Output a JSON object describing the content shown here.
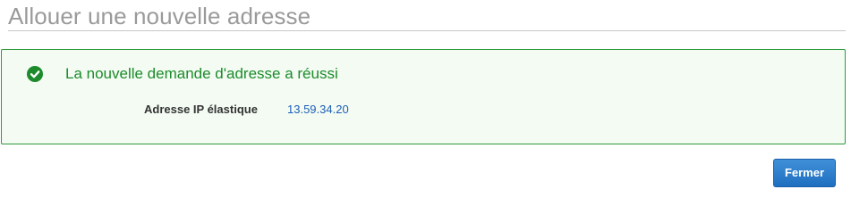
{
  "dialog": {
    "title": "Allouer une nouvelle adresse"
  },
  "success": {
    "icon": "check-circle-icon",
    "message": "La nouvelle demande d'adresse a réussi",
    "color": "#1d8b2b",
    "field_label": "Adresse IP élastique",
    "field_value": "13.59.34.20",
    "value_color": "#1f5fb5"
  },
  "footer": {
    "close_label": "Fermer",
    "accent": "#1f6fc1"
  }
}
